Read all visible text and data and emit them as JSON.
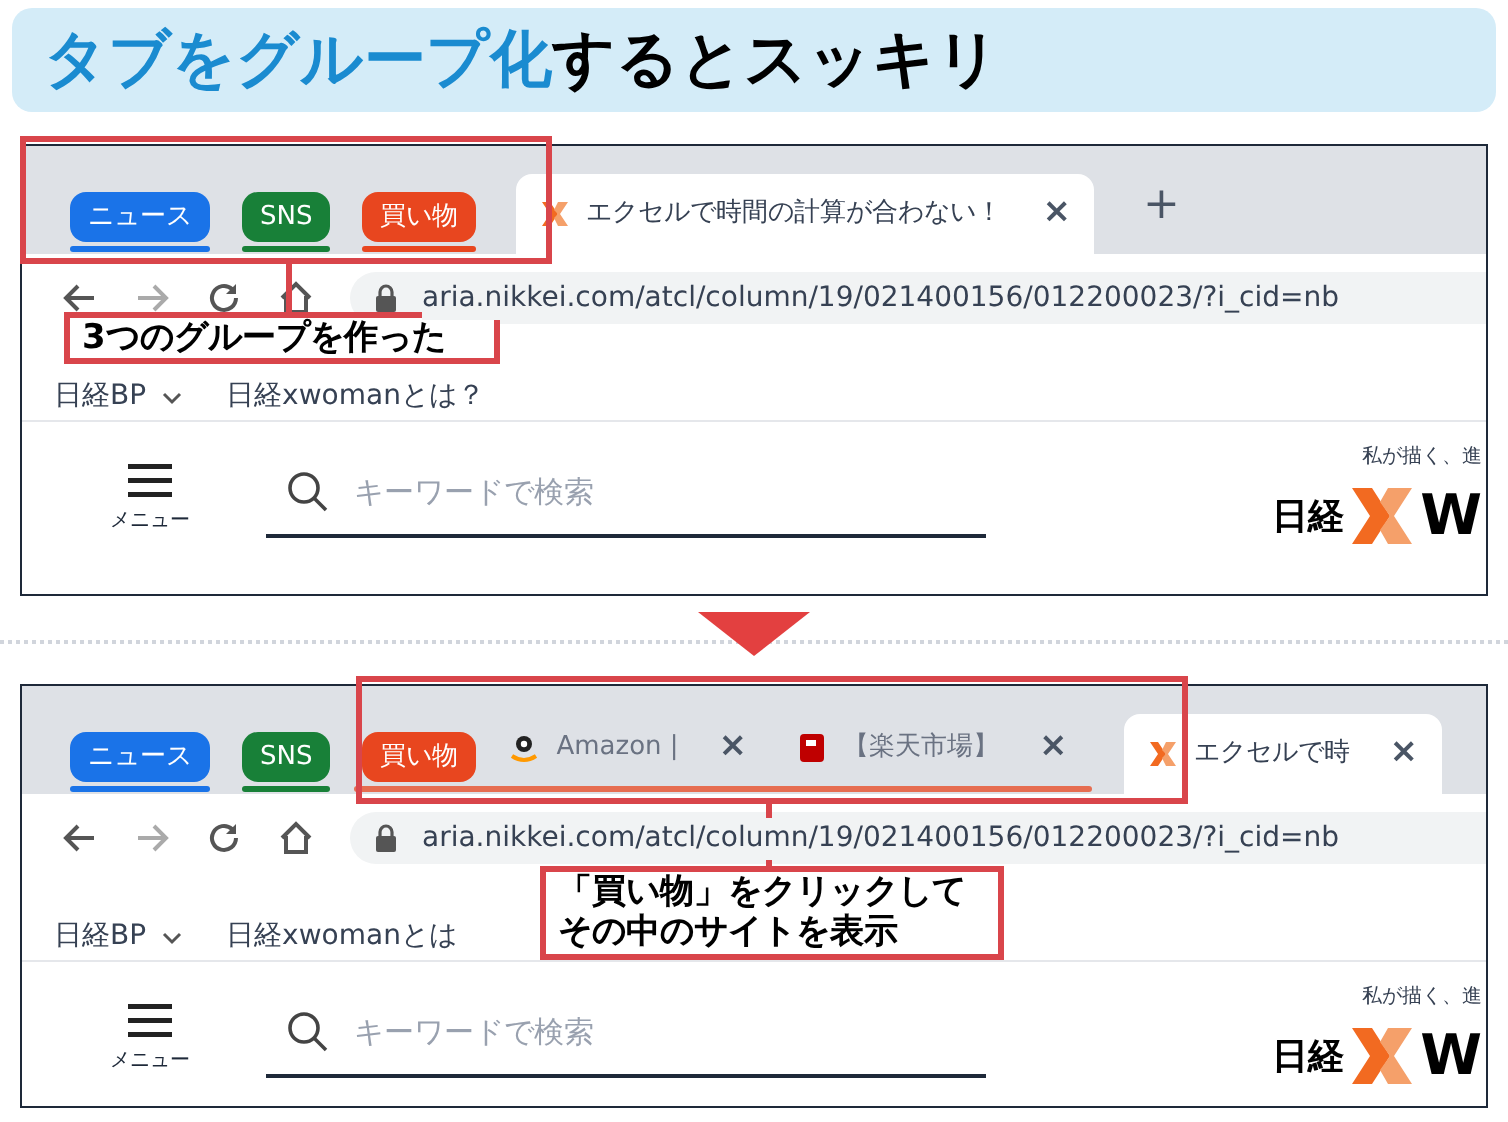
{
  "title": {
    "highlight": "タブをグループ化",
    "rest": "するとスッキリ"
  },
  "screenshots": [
    {
      "tabs": [
        {
          "kind": "group",
          "label": "ニュース",
          "color": "#1a73e8",
          "expanded": false
        },
        {
          "kind": "group",
          "label": "SNS",
          "color": "#188038",
          "expanded": false
        },
        {
          "kind": "group",
          "label": "買い物",
          "color": "#e8461f",
          "expanded": false
        },
        {
          "kind": "tab",
          "label": "エクセルで時間の計算が合わない！",
          "close": "×",
          "selected": true
        }
      ],
      "new_tab": "+",
      "url": "aria.nikkei.com/atcl/column/19/021400156/012200023/?i_cid=nb",
      "bookmarks": [
        {
          "label": "日経BP",
          "dropdown": true
        },
        {
          "label": "日経xwomanとは？",
          "dropdown": false
        }
      ],
      "menu_label": "メニュー",
      "search_placeholder": "キーワードで検索",
      "tagline": "私が描く、進",
      "logo": "日経",
      "logo_letter": "W",
      "callout": {
        "lines": [
          "3つのグループを作った"
        ]
      }
    },
    {
      "tabs": [
        {
          "kind": "group",
          "label": "ニュース",
          "color": "#1a73e8",
          "expanded": false
        },
        {
          "kind": "group",
          "label": "SNS",
          "color": "#188038",
          "expanded": false
        },
        {
          "kind": "group",
          "label": "買い物",
          "color": "#e8461f",
          "expanded": true,
          "tabs": [
            {
              "kind": "tab",
              "label": "Amazon |",
              "close": "×",
              "selected": false
            },
            {
              "kind": "tab",
              "label": "【楽天市場】",
              "close": "×",
              "selected": false
            }
          ]
        },
        {
          "kind": "tab",
          "label": "エクセルで時",
          "close": "×",
          "selected": true
        }
      ],
      "url": "aria.nikkei.com/atcl/column/19/021400156/012200023/?i_cid=nb",
      "bookmarks": [
        {
          "label": "日経BP",
          "dropdown": true
        },
        {
          "label": "日経xwomanとは",
          "dropdown": false
        }
      ],
      "menu_label": "メニュー",
      "search_placeholder": "キーワードで検索",
      "tagline": "私が描く、進",
      "logo": "日経",
      "logo_letter": "W",
      "callout": {
        "lines": [
          "「買い物」をクリックして",
          "その中のサイトを表示"
        ]
      }
    }
  ]
}
